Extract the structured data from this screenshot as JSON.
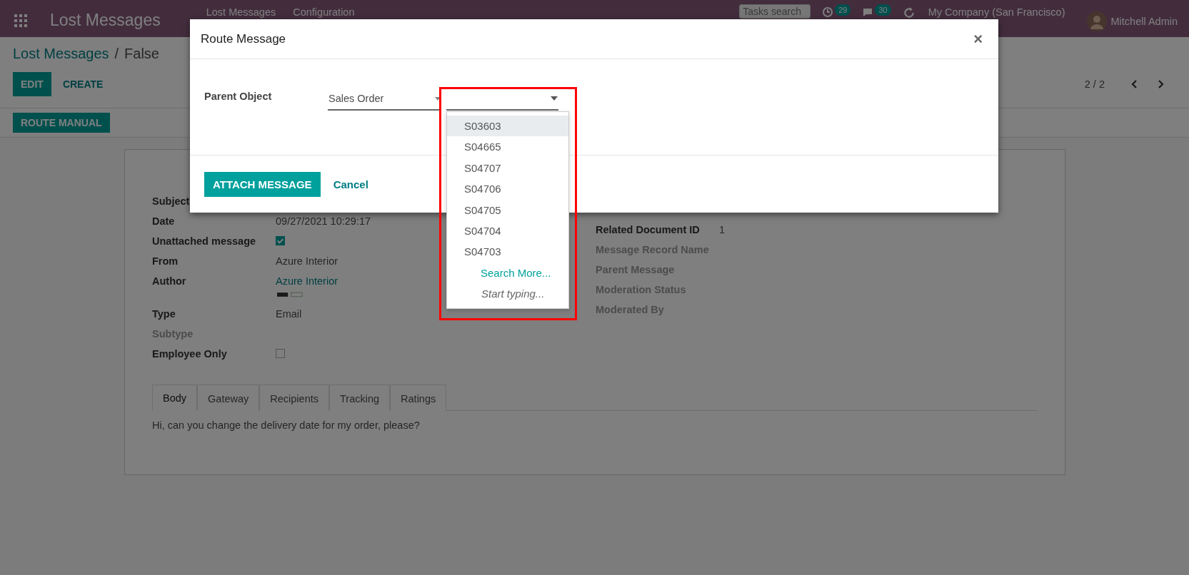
{
  "navbar": {
    "brand": "Lost Messages",
    "menus": [
      "Lost Messages",
      "Configuration"
    ],
    "search_placeholder": "Tasks search",
    "activity_count": "29",
    "message_count": "30",
    "company": "My Company (San Francisco)",
    "user": "Mitchell Admin"
  },
  "breadcrumb": {
    "parent": "Lost Messages",
    "separator": "/",
    "current": "False"
  },
  "buttons": [
    {
      "label": "EDIT",
      "kind": "primary"
    },
    {
      "label": "CREATE",
      "kind": "link"
    }
  ],
  "pager": "2 / 2",
  "action_buttons": [
    "ROUTE MANUAL"
  ],
  "form": {
    "left": [
      {
        "label": "Subject",
        "kind": "text",
        "muted": false
      },
      {
        "label": "Date",
        "kind": "text",
        "value": "09/27/2021 10:29:17",
        "muted": false
      },
      {
        "label": "Unattached message",
        "kind": "checkbox",
        "checked": true,
        "muted": false
      },
      {
        "label": "From",
        "kind": "text",
        "value": "Azure Interior",
        "muted": false
      },
      {
        "label": "Author",
        "kind": "link",
        "value": "Azure Interior",
        "tags": true,
        "muted": false
      },
      {
        "label": "Type",
        "kind": "text",
        "value": "Email",
        "muted": false
      },
      {
        "label": "Subtype",
        "kind": "text",
        "muted": true
      },
      {
        "label": "Employee Only",
        "kind": "checkbox",
        "checked": false,
        "muted": false
      }
    ],
    "right": [
      {
        "label": "Related Document ID",
        "kind": "text",
        "value": "1",
        "muted": false
      },
      {
        "label": "Message Record Name",
        "kind": "text",
        "muted": true
      },
      {
        "label": "Parent Message",
        "kind": "text",
        "muted": true
      },
      {
        "label": "Moderation Status",
        "kind": "text",
        "muted": true
      },
      {
        "label": "Moderated By",
        "kind": "text",
        "muted": true
      }
    ]
  },
  "tabs": [
    {
      "label": "Body",
      "selected": true
    },
    {
      "label": "Gateway",
      "selected": false
    },
    {
      "label": "Recipients",
      "selected": false
    },
    {
      "label": "Tracking",
      "selected": false
    },
    {
      "label": "Ratings",
      "selected": false
    }
  ],
  "body_text": "Hi, can you change the delivery date for my order, please?",
  "dialog": {
    "title": "Route Message",
    "close": "×",
    "field_label": "Parent Object",
    "model_value": "Sales Order",
    "dropdown": [
      {
        "label": "S03603",
        "selected": true
      },
      {
        "label": "S04665",
        "selected": false
      },
      {
        "label": "S04707",
        "selected": false
      },
      {
        "label": "S04706",
        "selected": false
      },
      {
        "label": "S04705",
        "selected": false
      },
      {
        "label": "S04704",
        "selected": false
      },
      {
        "label": "S04703",
        "selected": false
      }
    ],
    "search_more": "Search More...",
    "hint": "Start typing...",
    "buttons": [
      {
        "label": "ATTACH MESSAGE",
        "kind": "primary"
      },
      {
        "label": "Cancel",
        "kind": "link"
      }
    ]
  }
}
